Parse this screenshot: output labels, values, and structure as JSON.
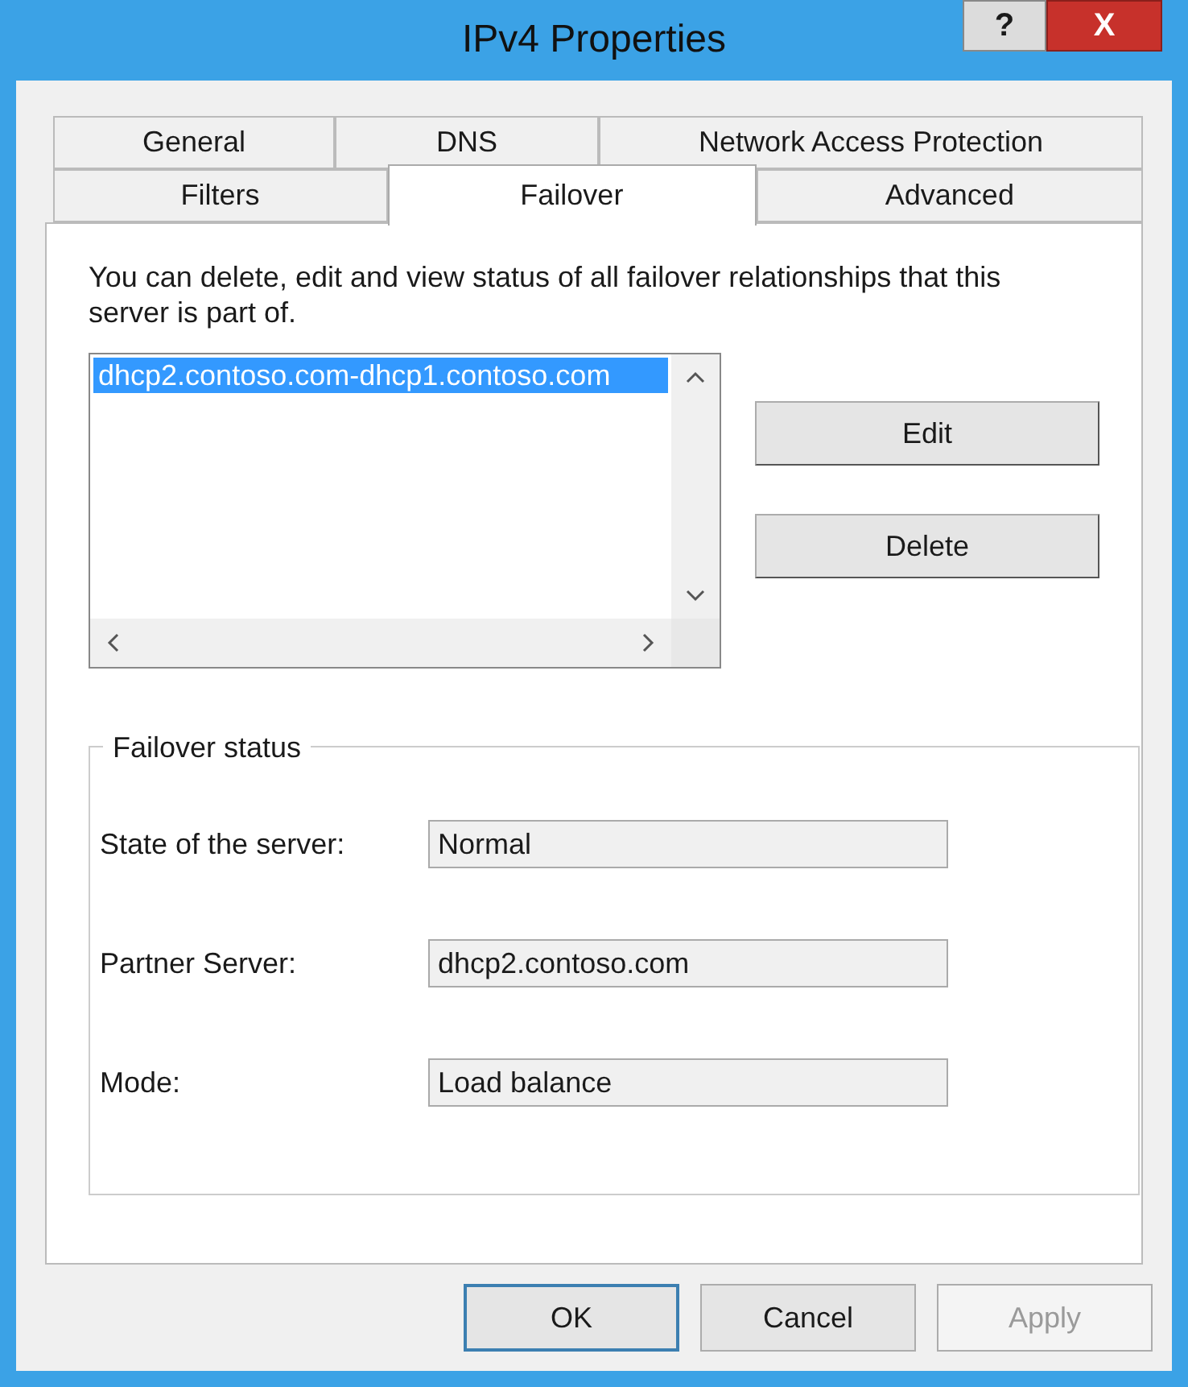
{
  "window": {
    "title": "IPv4 Properties",
    "help_button": "?",
    "close_button": "X"
  },
  "tab_rows": [
    {
      "tabs": [
        {
          "label": "General",
          "selected": false
        },
        {
          "label": "DNS",
          "selected": false
        },
        {
          "label": "Network Access Protection",
          "selected": false
        }
      ]
    },
    {
      "tabs": [
        {
          "label": "Filters",
          "selected": false
        },
        {
          "label": "Failover",
          "selected": true
        },
        {
          "label": "Advanced",
          "selected": false
        }
      ]
    }
  ],
  "description": "You can delete, edit and view status of all failover relationships that this server is part of.",
  "relationships": [
    {
      "text": "dhcp2.contoso.com-dhcp1.contoso.com",
      "selected": true
    }
  ],
  "buttons": [
    {
      "label": "Edit"
    },
    {
      "label": "Delete"
    }
  ],
  "failover_status": {
    "title": "Failover status",
    "fields": [
      {
        "label": "State of the server:",
        "value": "Normal"
      },
      {
        "label": "Partner Server:",
        "value": "dhcp2.contoso.com"
      },
      {
        "label": "Mode:",
        "value": "Load balance"
      }
    ]
  },
  "dialog_buttons": [
    {
      "label": "OK",
      "default": true,
      "disabled": false
    },
    {
      "label": "Cancel",
      "default": false,
      "disabled": false
    },
    {
      "label": "Apply",
      "default": false,
      "disabled": true
    }
  ]
}
